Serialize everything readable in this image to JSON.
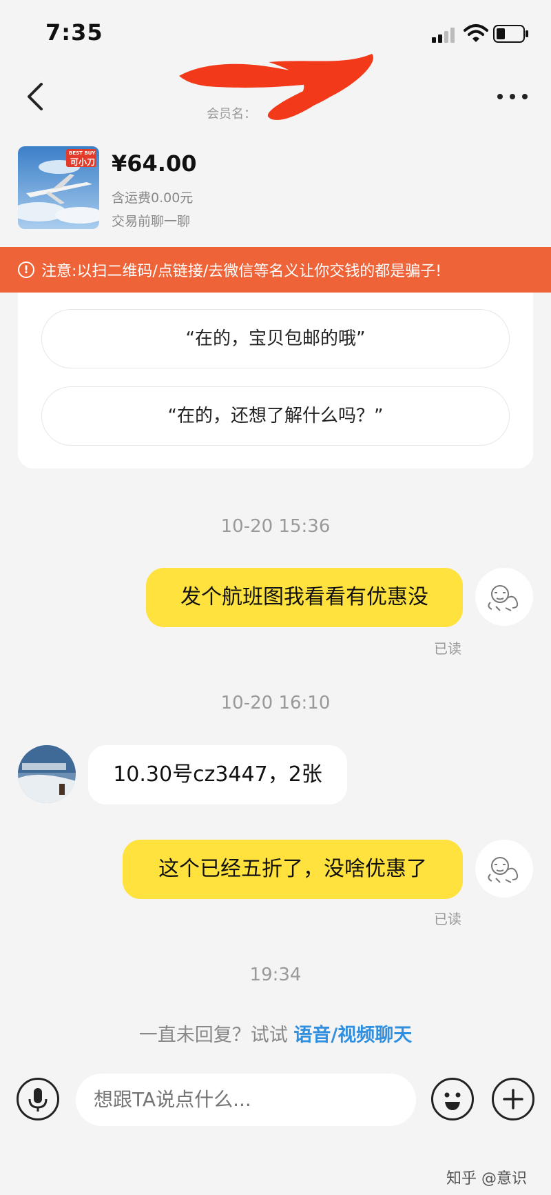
{
  "status": {
    "time": "7:35"
  },
  "header": {
    "title": "",
    "subtitle": "会员名：",
    "menu_icon": "ellipsis-icon",
    "back_icon": "back-chevron-icon"
  },
  "product": {
    "price": "¥64.00",
    "shipping": "含运费0.00元",
    "prompt": "交易前聊一聊",
    "badge_top": "BEST BUY",
    "badge": "可小刀"
  },
  "warning": {
    "text": "注意:以扫二维码/点链接/去微信等名义让你交钱的都是骗子!",
    "color": "#ee6338"
  },
  "quick_replies": [
    "“在的，宝贝包邮的哦”",
    "“在的，还想了解什么吗？”"
  ],
  "messages": [
    {
      "timestamp": "10-20 15:36",
      "side": "right",
      "text": "发个航班图我看看有优惠没",
      "status": "已读"
    },
    {
      "timestamp": "10-20 16:10",
      "side": "left",
      "text": "10.30号cz3447，2张"
    },
    {
      "side": "right",
      "text": "这个已经五折了，没啥优惠了",
      "status": "已读"
    },
    {
      "timestamp": "19:34"
    }
  ],
  "hint": {
    "text": "一直未回复？试试 ",
    "link": "语音/视频聊天"
  },
  "input": {
    "placeholder": "想跟TA说点什么..."
  },
  "watermark": "知乎 @意识",
  "colors": {
    "bubble_me": "#ffe23e",
    "link": "#2f8fe0",
    "background": "#f4f4f4"
  }
}
